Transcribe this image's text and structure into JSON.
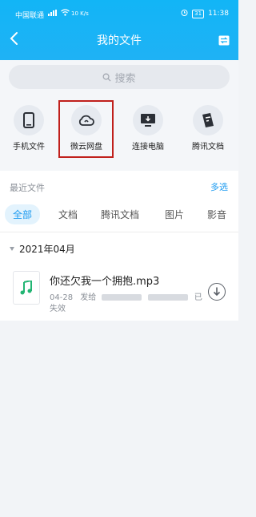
{
  "status_bar": {
    "carrier": "中国联通",
    "net_speed": "10 K/s",
    "battery": "31",
    "time": "11:38"
  },
  "header": {
    "title": "我的文件",
    "back_icon": "chevron-left-icon",
    "right_icon": "switch-icon"
  },
  "search": {
    "placeholder": "搜索"
  },
  "quick_access": [
    {
      "label": "手机文件",
      "icon": "phone-icon"
    },
    {
      "label": "微云网盘",
      "icon": "cloud-icon"
    },
    {
      "label": "连接电脑",
      "icon": "monitor-icon"
    },
    {
      "label": "腾讯文档",
      "icon": "document-icon"
    }
  ],
  "recent": {
    "label": "最近文件",
    "multi_select": "多选"
  },
  "tabs": [
    {
      "label": "全部",
      "active": true
    },
    {
      "label": "文档",
      "active": false
    },
    {
      "label": "腾讯文档",
      "active": false
    },
    {
      "label": "图片",
      "active": false
    },
    {
      "label": "影音",
      "active": false
    }
  ],
  "files": {
    "month": "2021年04月",
    "items": [
      {
        "name": "你还欠我一个拥抱.mp3",
        "date": "04-28",
        "sent_to": "发给",
        "status_part1": "已",
        "status_part2": "失效"
      }
    ]
  },
  "colors": {
    "header": "#12b5f6",
    "accent": "#1d9bf0",
    "highlight_border": "#c0201c",
    "music_icon": "#22b573"
  }
}
